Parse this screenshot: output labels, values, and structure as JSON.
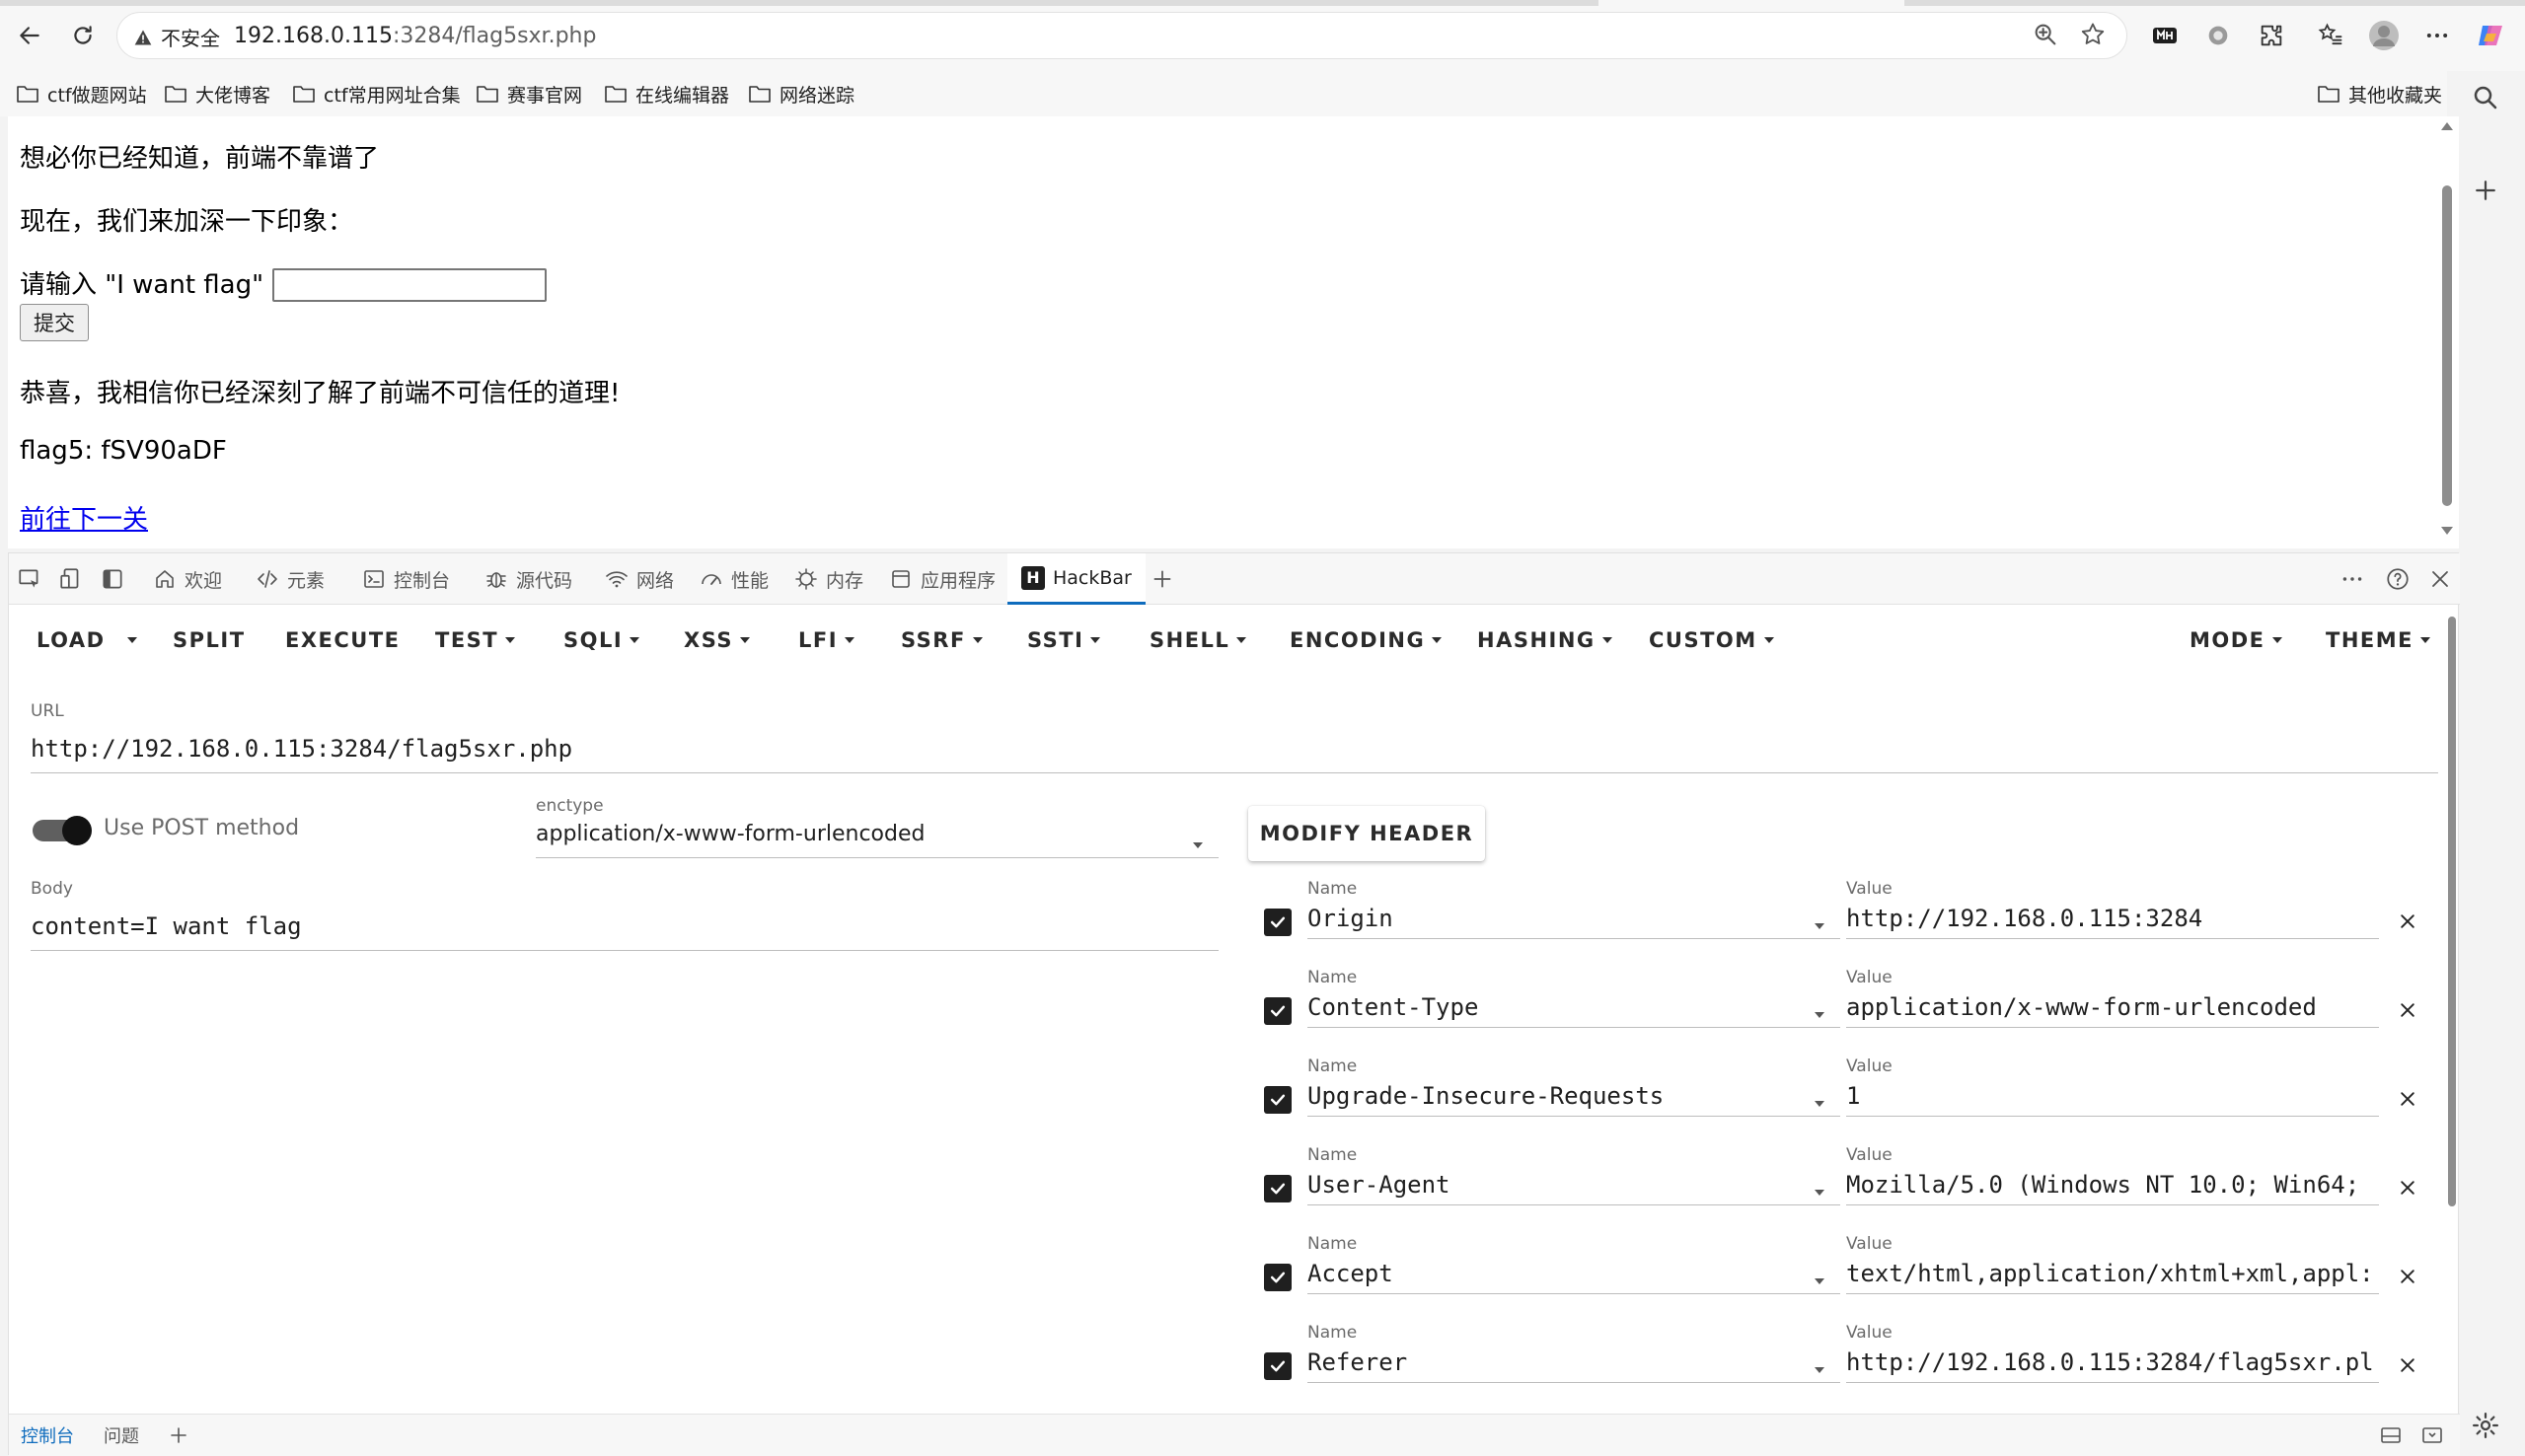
{
  "browser": {
    "security_label": "不安全",
    "url_host": "192.168.0.115",
    "url_path": ":3284/flag5sxr.php"
  },
  "bookmarks": {
    "items": [
      "ctf做题网站",
      "大佬博客",
      "ctf常用网址合集",
      "赛事官网",
      "在线编辑器",
      "网络迷踪"
    ],
    "other": "其他收藏夹"
  },
  "page": {
    "line1": "想必你已经知道，前端不靠谱了",
    "line2": "现在，我们来加深一下印象：",
    "input_label": "请输入 \"I want flag\" :",
    "submit_label": "提交",
    "congrats": "恭喜，我相信你已经深刻了解了前端不可信任的道理!",
    "flag": "flag5: fSV90aDF",
    "next_link": "前往下一关"
  },
  "devtools": {
    "tabs": [
      "欢迎",
      "元素",
      "控制台",
      "源代码",
      "网络",
      "性能",
      "内存",
      "应用程序",
      "HackBar"
    ],
    "active_tab": "HackBar",
    "drawer_tabs": [
      "控制台",
      "问题"
    ]
  },
  "hackbar": {
    "menu": {
      "load": "LOAD",
      "split": "SPLIT",
      "execute": "EXECUTE",
      "test": "TEST",
      "sqli": "SQLI",
      "xss": "XSS",
      "lfi": "LFI",
      "ssrf": "SSRF",
      "ssti": "SSTI",
      "shell": "SHELL",
      "encoding": "ENCODING",
      "hashing": "HASHING",
      "custom": "CUSTOM",
      "mode": "MODE",
      "theme": "THEME"
    },
    "url_label": "URL",
    "url_value": "http://192.168.0.115:3284/flag5sxr.php",
    "post_label": "Use POST method",
    "post_enabled": true,
    "enctype_label": "enctype",
    "enctype_value": "application/x-www-form-urlencoded",
    "body_label": "Body",
    "body_value": "content=I want flag",
    "modify_header_label": "MODIFY HEADER",
    "name_label": "Name",
    "value_label": "Value",
    "headers": [
      {
        "name": "Origin",
        "value": "http://192.168.0.115:3284"
      },
      {
        "name": "Content-Type",
        "value": "application/x-www-form-urlencoded"
      },
      {
        "name": "Upgrade-Insecure-Requests",
        "value": "1"
      },
      {
        "name": "User-Agent",
        "value": "Mozilla/5.0 (Windows NT 10.0; Win64;"
      },
      {
        "name": "Accept",
        "value": "text/html,application/xhtml+xml,appl:"
      },
      {
        "name": "Referer",
        "value": "http://192.168.0.115:3284/flag5sxr.pl"
      }
    ]
  }
}
